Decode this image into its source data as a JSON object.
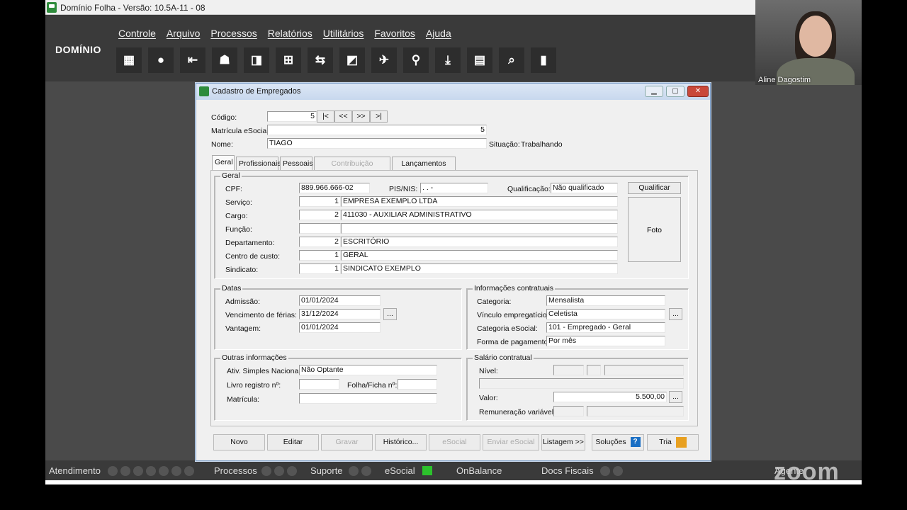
{
  "window": {
    "title": "Domínio Folha - Versão: 10.5A-11 - 08"
  },
  "brand": "DOMÍNIO",
  "menus": [
    "Controle",
    "Arquivo",
    "Processos",
    "Relatórios",
    "Utilitários",
    "Favoritos",
    "Ajuda"
  ],
  "toolbar_icons": [
    "building-icon",
    "user-icon",
    "import-icon",
    "users-icon",
    "document-icon",
    "calculator-grid-icon",
    "transfer-icon",
    "file-export-icon",
    "airplane-icon",
    "search-icon",
    "download-icon",
    "calculator-icon",
    "chart-search-icon",
    "notebook-icon"
  ],
  "webcam": {
    "name": "Aline Dagostim"
  },
  "dialog": {
    "title": "Cadastro de Empregados",
    "codigo_label": "Código:",
    "codigo": "5",
    "nav": [
      "|<",
      "<<",
      ">>",
      ">|"
    ],
    "matricula_label": "Matrícula eSocial:",
    "matricula": "5",
    "nome_label": "Nome:",
    "nome": "TIAGO",
    "situacao_label": "Situação:",
    "situacao": "Trabalhando",
    "tabs": [
      "Geral",
      "Profissionais",
      "Pessoais",
      "Contribuição Individual",
      "Lançamentos Fixos"
    ],
    "geral": {
      "title": "Geral",
      "cpf_label": "CPF:",
      "cpf": "889.966.666-02",
      "pis_label": "PIS/NIS:",
      "pis": "  .     .     -",
      "qual_label": "Qualificação:",
      "qualificacao": "Não qualificado",
      "qualificar": "Qualificar",
      "foto": "Foto",
      "servico_label": "Serviço:",
      "servico_cod": "1",
      "servico": "EMPRESA EXEMPLO LTDA",
      "cargo_label": "Cargo:",
      "cargo_cod": "2",
      "cargo": "411030 - AUXILIAR ADMINISTRATIVO",
      "funcao_label": "Função:",
      "depto_label": "Departamento:",
      "depto_cod": "2",
      "depto": "ESCRITÓRIO",
      "cc_label": "Centro de custo:",
      "cc_cod": "1",
      "cc": "GERAL",
      "sind_label": "Sindicato:",
      "sind_cod": "1",
      "sind": "SINDICATO EXEMPLO"
    },
    "datas": {
      "title": "Datas",
      "adm_label": "Admissão:",
      "admissao": "01/01/2024",
      "ferias_label": "Vencimento de férias:",
      "ferias": "31/12/2024",
      "vant_label": "Vantagem:",
      "vantagem": "01/01/2024"
    },
    "contrat": {
      "title": "Informações contratuais",
      "cat_label": "Categoria:",
      "categoria": "Mensalista",
      "vinc_label": "Vínculo empregatício:",
      "vinculo": "Celetista",
      "cates_label": "Categoria eSocial:",
      "cat_esocial": "101 - Empregado - Geral",
      "forma_label": "Forma de pagamento:",
      "forma": "Por mês"
    },
    "outras": {
      "title": "Outras informações",
      "simples_label": "Ativ. Simples Nacional:",
      "simples": "Não Optante",
      "livro_label": "Livro registro nº:",
      "folha_label": "Folha/Ficha nº:",
      "matricula_label": "Matrícula:"
    },
    "salario": {
      "title": "Salário contratual",
      "nivel_label": "Nível:",
      "valor_label": "Valor:",
      "valor": "5.500,00",
      "remun_label": "Remuneração variável:"
    },
    "ellipsis": "...",
    "buttons": [
      "Novo",
      "Editar",
      "Gravar",
      "Histórico...",
      "eSocial",
      "Enviar eSocial",
      "Listagem >>",
      "Soluções",
      "Tria"
    ]
  },
  "statusbar": [
    "Atendimento",
    "Processos",
    "Suporte",
    "eSocial",
    "OnBalance",
    "Docs Fiscais",
    "Agente"
  ],
  "zoom_logo": "zoom"
}
